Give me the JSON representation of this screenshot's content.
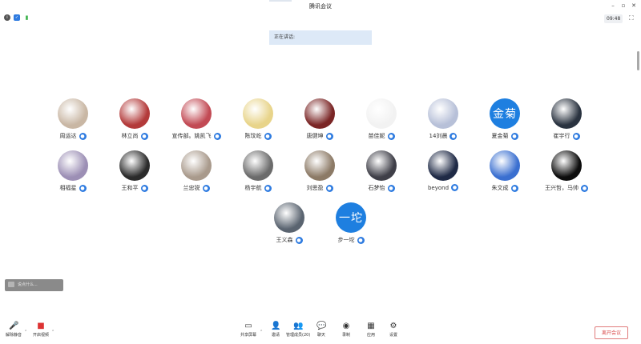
{
  "window": {
    "title": "腾讯会议",
    "timer": "09:48"
  },
  "speaking_banner": "正在讲话:",
  "participants": [
    {
      "name": "周运达",
      "avatar_type": "photo",
      "avatar_color": "#c9b7a4"
    },
    {
      "name": "林立尚",
      "avatar_type": "photo",
      "avatar_color": "#b33a3a"
    },
    {
      "name": "宣传部。姚凯飞",
      "avatar_type": "photo",
      "avatar_color": "#c24a54"
    },
    {
      "name": "陈玟屹",
      "avatar_type": "photo",
      "avatar_color": "#e8d48a"
    },
    {
      "name": "唐健坤",
      "avatar_type": "photo",
      "avatar_color": "#7a2525"
    },
    {
      "name": "苗佳妮",
      "avatar_type": "photo",
      "avatar_color": "#f2f2f2"
    },
    {
      "name": "14刘晨",
      "avatar_type": "photo",
      "avatar_color": "#b7c0d8"
    },
    {
      "name": "夏金菊",
      "avatar_type": "text",
      "avatar_text": "金菊",
      "avatar_color": "#1e7fe0"
    },
    {
      "name": "崔宇行",
      "avatar_type": "photo",
      "avatar_color": "#2a3340"
    },
    {
      "name": "相福星",
      "avatar_type": "photo",
      "avatar_color": "#9c8fb5"
    },
    {
      "name": "王和平",
      "avatar_type": "photo",
      "avatar_color": "#2b2b2b"
    },
    {
      "name": "兰忠锐",
      "avatar_type": "photo",
      "avatar_color": "#a99a8c"
    },
    {
      "name": "杨宇航",
      "avatar_type": "photo",
      "avatar_color": "#6b6b6b"
    },
    {
      "name": "刘思盈",
      "avatar_type": "photo",
      "avatar_color": "#8c7a66"
    },
    {
      "name": "石梦怡",
      "avatar_type": "photo",
      "avatar_color": "#3f3f48"
    },
    {
      "name": "beyond",
      "avatar_type": "photo",
      "avatar_color": "#1f2a46"
    },
    {
      "name": "朱文成",
      "avatar_type": "photo",
      "avatar_color": "#3a6fd0"
    },
    {
      "name": "王兴哲，马帅",
      "avatar_type": "photo",
      "avatar_color": "#0d0d0d"
    },
    {
      "name": "王义森",
      "avatar_type": "photo",
      "avatar_color": "#5a6470"
    },
    {
      "name": "步一坨",
      "avatar_type": "text",
      "avatar_text": "一坨",
      "avatar_color": "#1e7fe0"
    }
  ],
  "chat_placeholder": "说点什么...",
  "toolbar": {
    "unmute": "解除静音",
    "video": "开启视频",
    "share": "共享屏幕",
    "invite": "邀请",
    "members": "管理成员(20)",
    "chat": "聊天",
    "record": "录制",
    "apps": "应用",
    "settings": "设置",
    "leave": "离开会议"
  }
}
